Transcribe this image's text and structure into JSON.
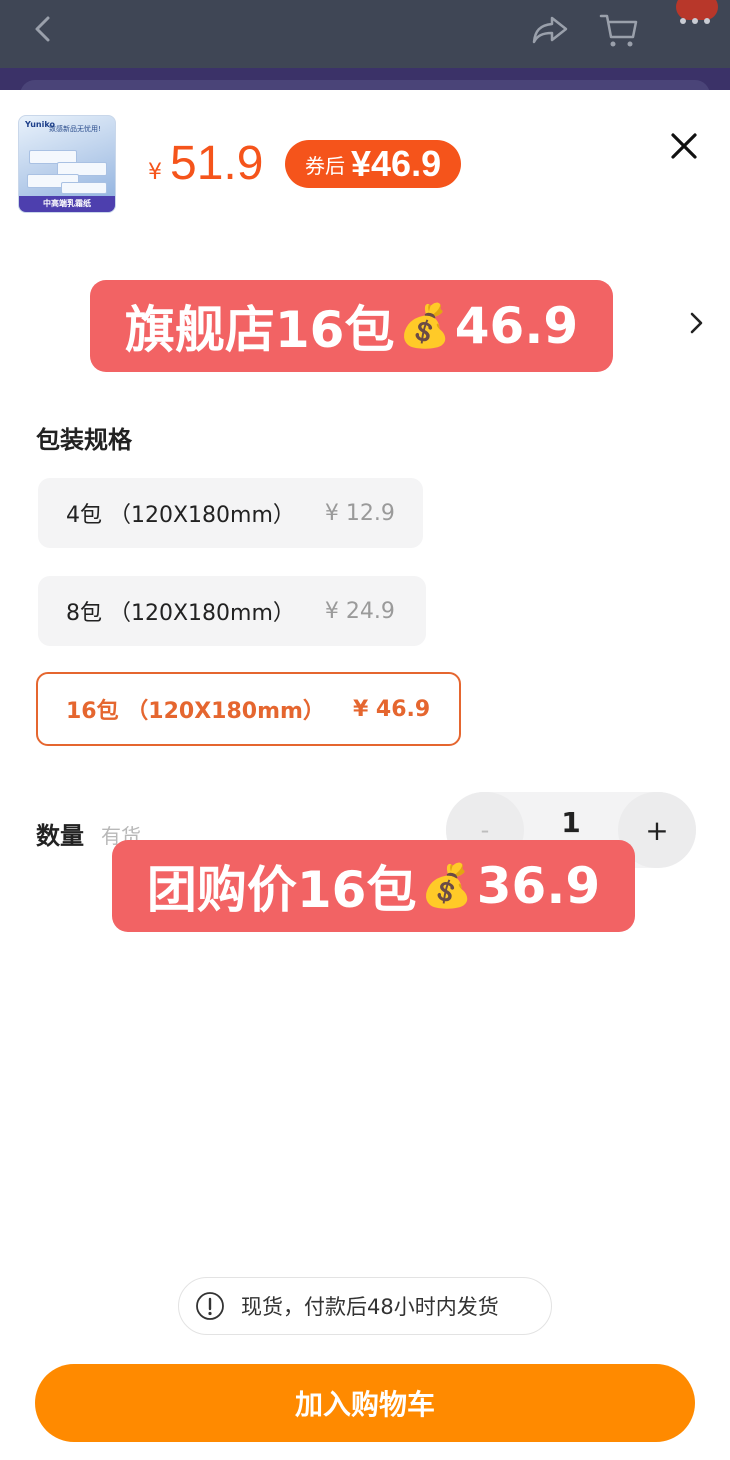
{
  "top_bar": {
    "icons": [
      "chevron-left-icon",
      "share-icon",
      "cart-icon",
      "more-icon"
    ]
  },
  "product": {
    "thumbnail": {
      "brand": "Yuniko",
      "slogan": "致感新品无忧用!",
      "band_text": "中高端乳霜纸"
    },
    "currency": "¥",
    "price": "51.9",
    "coupon_label": "券后",
    "coupon_price": "¥46.9"
  },
  "overlays": {
    "banner_one": {
      "text_before": "旗舰店16包",
      "emoji": "💰",
      "text_after": "46.9"
    },
    "banner_two": {
      "text_before": "团购价16包",
      "emoji": "💰",
      "text_after": "36.9"
    }
  },
  "specs": {
    "title": "包装规格",
    "options": [
      {
        "label": "4包 （120X180mm）",
        "price": "¥ 12.9",
        "selected": false
      },
      {
        "label": "8包 （120X180mm）",
        "price": "¥ 24.9",
        "selected": false
      },
      {
        "label": "16包 （120X180mm）",
        "price": "¥ 46.9",
        "selected": true
      }
    ]
  },
  "quantity": {
    "label": "数量",
    "stock": "有货",
    "minus": "-",
    "value": "1",
    "plus": "+"
  },
  "notice": {
    "icon": "info-icon",
    "text": "现货，付款后48小时内发货"
  },
  "cta": {
    "label": "加入购物车"
  },
  "colors": {
    "accent": "#f5541b",
    "cta": "#ff8a00",
    "overlay": "#f26364",
    "selected_border": "#e5662f"
  }
}
